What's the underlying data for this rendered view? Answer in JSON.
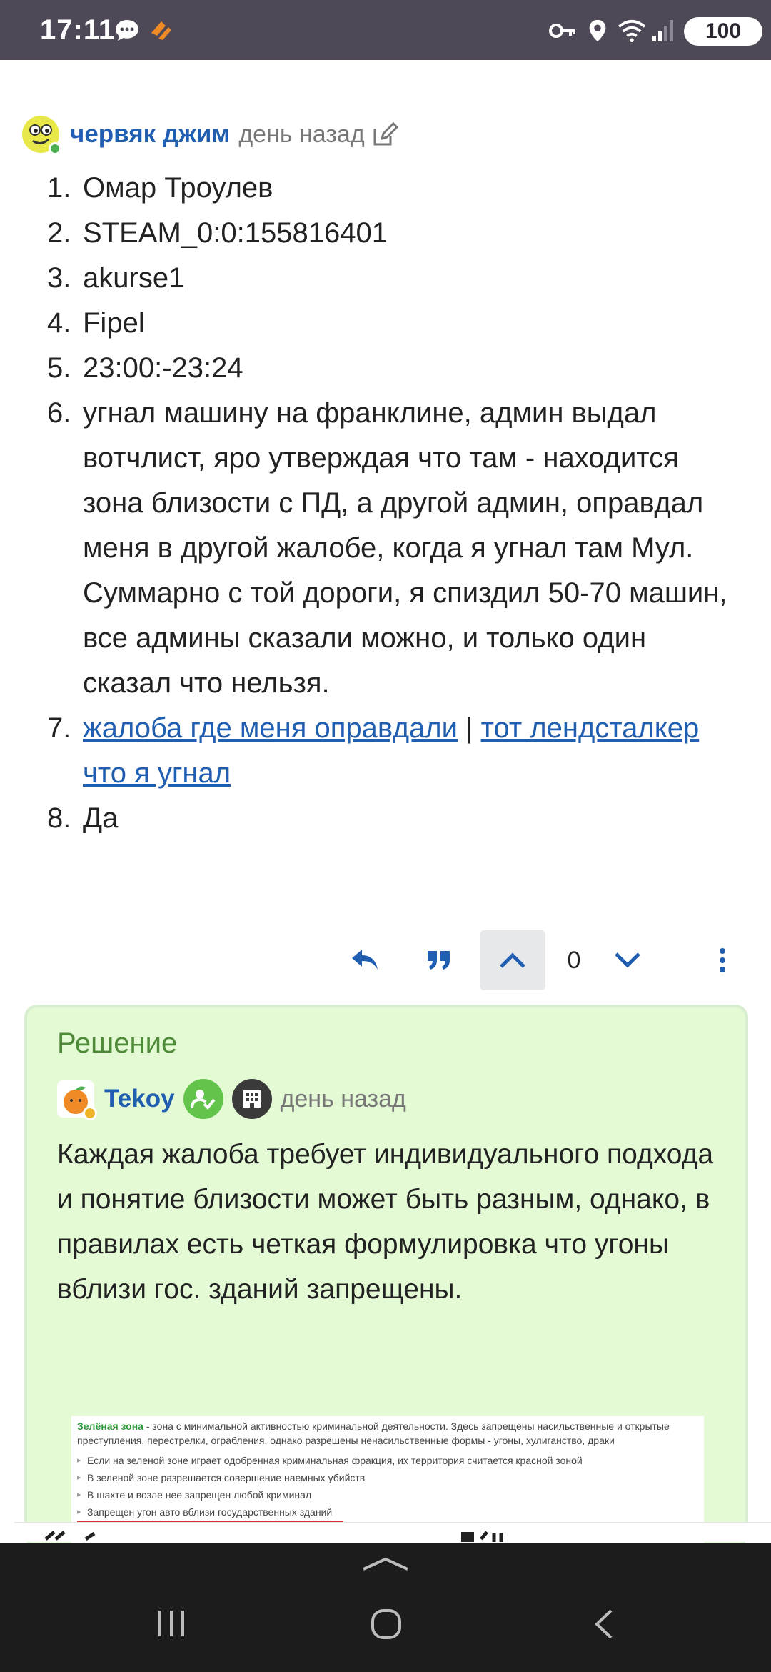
{
  "status_bar": {
    "time": "17:11",
    "battery": "100",
    "icons": [
      "chat-bubble-icon",
      "app-logo-icon",
      "key-icon",
      "location-icon",
      "wifi-icon",
      "signal-icon"
    ]
  },
  "post": {
    "username": "червяк джим",
    "date": "день назад",
    "items": [
      {
        "num": "1.",
        "text": "Омар Троулев"
      },
      {
        "num": "2.",
        "text": "STEAM_0:0:155816401"
      },
      {
        "num": "3.",
        "text": "akurse1"
      },
      {
        "num": "4.",
        "text": "Fipel"
      },
      {
        "num": "5.",
        "text": "23:00:-23:24"
      },
      {
        "num": "6.",
        "text": "угнал машину на франклине, админ выдал вотчлист, яро утверждая что там - находится зона близости с ПД, а другой админ, оправдал меня в другой жалобе, когда я угнал там Мул. Суммарно с той дороги, я спиздил 50-70 машин, все админы сказали можно, и только один сказал что нельзя."
      },
      {
        "num": "7.",
        "link1": "жалоба где меня оправдали",
        "separator": "|",
        "link2": "тот лендсталкер что я угнал"
      },
      {
        "num": "8.",
        "text": "Да"
      }
    ],
    "vote_count": "0"
  },
  "solution": {
    "title": "Решение",
    "username": "Tekoy",
    "date": "день назад",
    "text": "Каждая жалоба требует индивидуального подхода и понятие близости может быть разным, однако, в правилах есть четкая формулировка что угоны вблизи гос. зданий запрещены.",
    "image": {
      "heading_bold": "Зелёная зона",
      "heading_rest": " - зона с минимальной активностью криминальной деятельности. Здесь запрещены насильственные и открытые преступления, перестрелки, ограбления, однако разрешены ненасильственные формы - угоны, хулиганство, драки",
      "items": [
        "Если на зеленой зоне играет одобренная криминальная фракция, их территория считается красной зоной",
        "В зеленой зоне разрешается совершение наемных убийств",
        "В шахте и возле нее запрещен любой криминал",
        "Запрещен угон авто вблизи государственных зданий"
      ]
    }
  }
}
